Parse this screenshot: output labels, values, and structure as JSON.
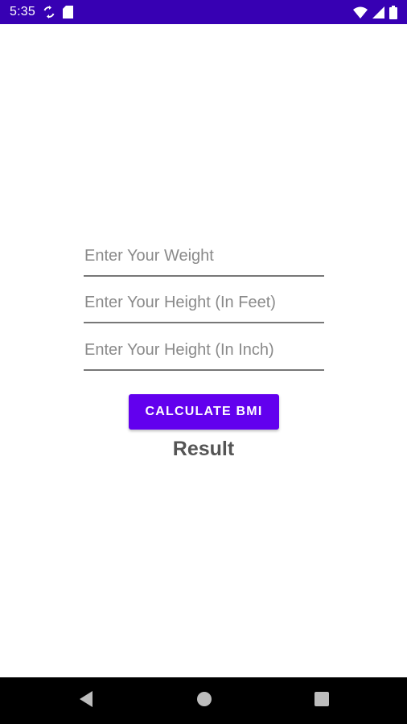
{
  "status_bar": {
    "time": "5:35",
    "background_color": "#3700b3",
    "icons": [
      "sync-icon",
      "sd-card-icon",
      "wifi-icon",
      "cellular-signal-icon",
      "battery-icon"
    ]
  },
  "form": {
    "weight_placeholder": "Enter Your Weight",
    "weight_value": "",
    "height_feet_placeholder": "Enter Your Height (In Feet)",
    "height_feet_value": "",
    "height_inch_placeholder": "Enter Your Height (In Inch)",
    "height_inch_value": "",
    "calculate_label": "CALCULATE BMI",
    "result_label": "Result"
  },
  "colors": {
    "primary": "#6200ee",
    "primary_dark": "#3700b3",
    "result_text": "#555555"
  },
  "nav_bar": {
    "icons": [
      "back-icon",
      "home-icon",
      "recents-icon"
    ]
  }
}
